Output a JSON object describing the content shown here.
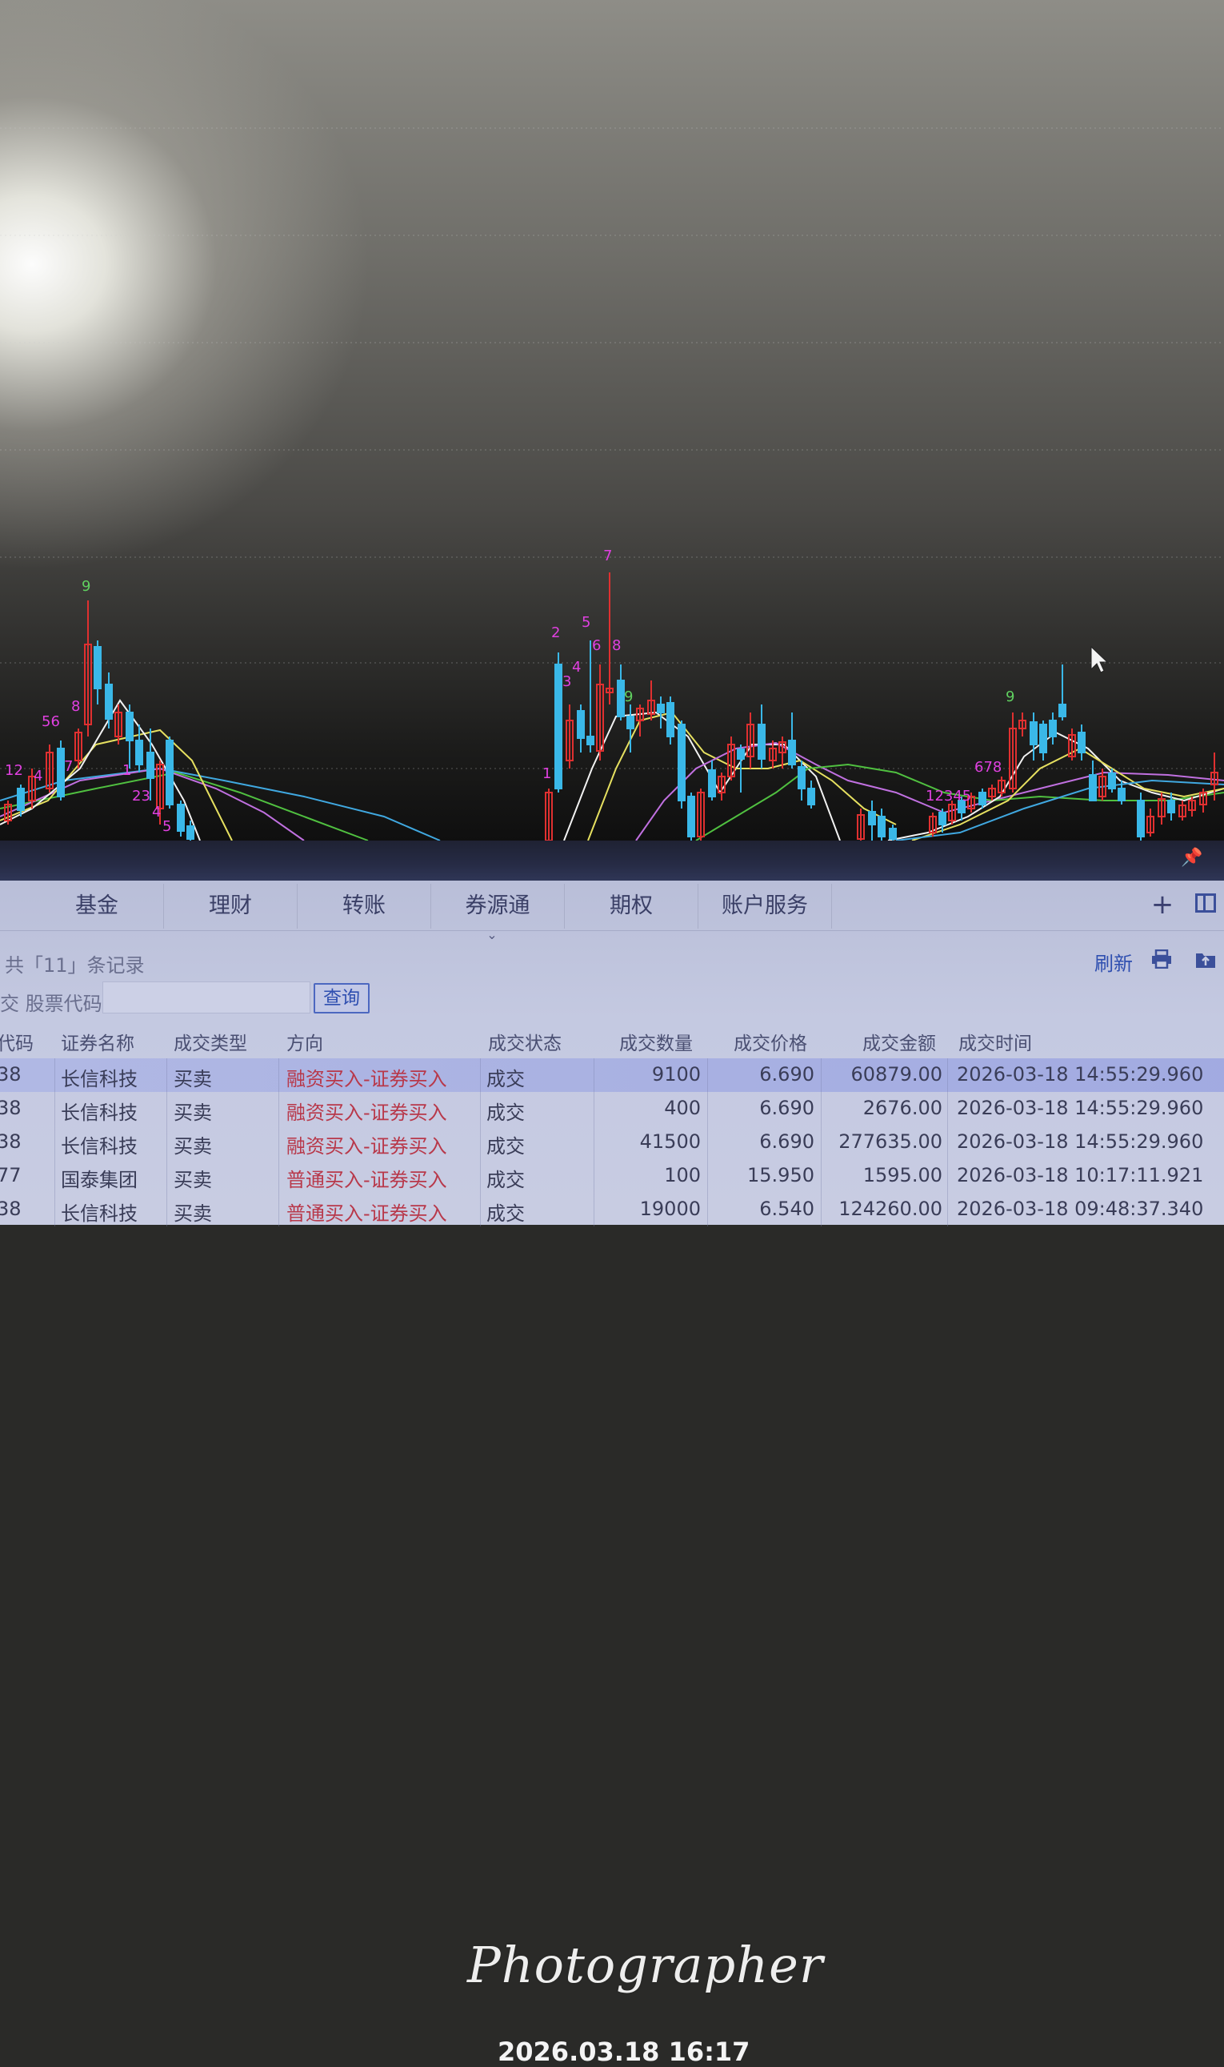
{
  "chart": {
    "labels": {
      "left_9": "9",
      "left_56": "56",
      "left_8": "8",
      "left_12": "12",
      "left_4": "4",
      "left_7": "7",
      "left_1": "1",
      "left_23": "23",
      "left_4b": "4",
      "left_5": "5",
      "mid_1": "1",
      "mid_2": "2",
      "mid_3": "3",
      "mid_4": "4",
      "mid_5": "5",
      "mid_6": "6",
      "mid_7": "7",
      "mid_8": "8",
      "mid_9": "9",
      "right_9": "9",
      "right_678": "678",
      "right_12345": "12345"
    },
    "colors": {
      "up": "#e03030",
      "down": "#3ab8e8",
      "ma_white": "#f2f2f2",
      "ma_yellow": "#e6e060",
      "ma_purple": "#c070e0",
      "ma_green": "#50c040",
      "ma_blue": "#40a8e0",
      "label_magenta": "#e040e0",
      "label_green": "#60d060"
    }
  },
  "tabs": [
    "基金",
    "理财",
    "转账",
    "券源通",
    "期权",
    "账户服务"
  ],
  "toolbar": {
    "plus": "+",
    "records": "共「11」条记录",
    "refresh": "刷新",
    "stock_code_label": "交 股票代码",
    "stock_code_value": "",
    "query": "查询"
  },
  "table": {
    "headers": {
      "code": "代码",
      "name": "证券名称",
      "type": "成交类型",
      "direction": "方向",
      "status": "成交状态",
      "qty": "成交数量",
      "price": "成交价格",
      "amount": "成交金额",
      "time": "成交时间"
    },
    "rows": [
      {
        "code": "38",
        "name": "长信科技",
        "type": "买卖",
        "direction": "融资买入-证券买入",
        "status": "成交",
        "qty": "9100",
        "price": "6.690",
        "amount": "60879.00",
        "time": "2026-03-18 14:55:29.960"
      },
      {
        "code": "38",
        "name": "长信科技",
        "type": "买卖",
        "direction": "融资买入-证券买入",
        "status": "成交",
        "qty": "400",
        "price": "6.690",
        "amount": "2676.00",
        "time": "2026-03-18 14:55:29.960"
      },
      {
        "code": "38",
        "name": "长信科技",
        "type": "买卖",
        "direction": "融资买入-证券买入",
        "status": "成交",
        "qty": "41500",
        "price": "6.690",
        "amount": "277635.00",
        "time": "2026-03-18 14:55:29.960"
      },
      {
        "code": "77",
        "name": "国泰集团",
        "type": "买卖",
        "direction": "普通买入-证券买入",
        "status": "成交",
        "qty": "100",
        "price": "15.950",
        "amount": "1595.00",
        "time": "2026-03-18 10:17:11.921"
      },
      {
        "code": "38",
        "name": "长信科技",
        "type": "买卖",
        "direction": "普通买入-证券买入",
        "status": "成交",
        "qty": "19000",
        "price": "6.540",
        "amount": "124260.00",
        "time": "2026-03-18 09:48:37.340"
      }
    ]
  },
  "watermark": {
    "brand": "Photographer",
    "datetime": "2026.03.18 16:17"
  }
}
